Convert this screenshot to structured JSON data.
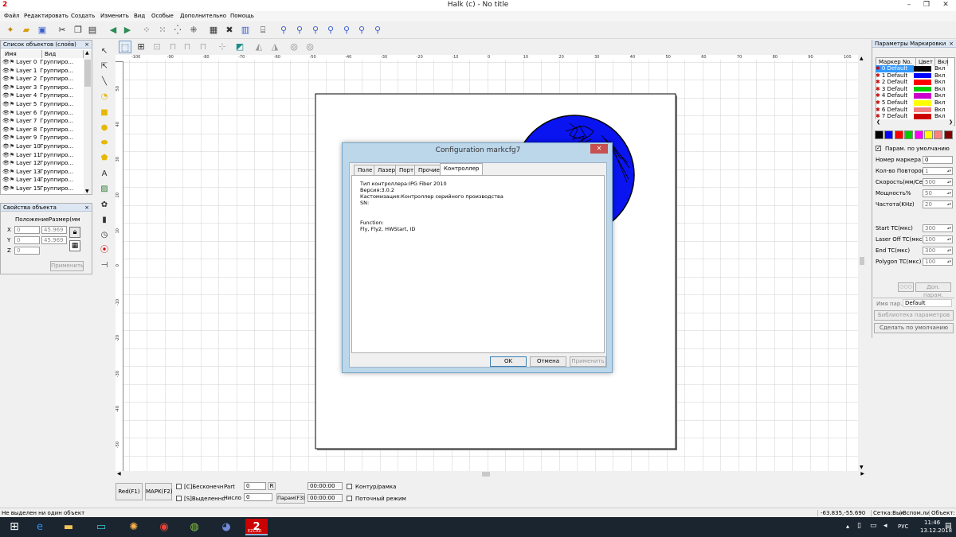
{
  "window": {
    "title": "Halk (c) - No title"
  },
  "menu": [
    "Файл",
    "Редактировать",
    "Создать",
    "Изменить",
    "Вид",
    "Особые",
    "Дополнительно",
    "Помощь"
  ],
  "layers_panel": {
    "title": "Список объектов (слоёв)",
    "close": "×",
    "columns": [
      "Имя",
      "Вид"
    ],
    "rows": [
      {
        "name": "Layer 0",
        "type": "Группиро..."
      },
      {
        "name": "Layer 1",
        "type": "Группиро..."
      },
      {
        "name": "Layer 2",
        "type": "Группиро..."
      },
      {
        "name": "Layer 3",
        "type": "Группиро..."
      },
      {
        "name": "Layer 4",
        "type": "Группиро..."
      },
      {
        "name": "Layer 5",
        "type": "Группиро..."
      },
      {
        "name": "Layer 6",
        "type": "Группиро..."
      },
      {
        "name": "Layer 7",
        "type": "Группиро..."
      },
      {
        "name": "Layer 8",
        "type": "Группиро..."
      },
      {
        "name": "Layer 9",
        "type": "Группиро..."
      },
      {
        "name": "Layer 10",
        "type": "Группиро..."
      },
      {
        "name": "Layer 11",
        "type": "Группиро..."
      },
      {
        "name": "Layer 12",
        "type": "Группиро..."
      },
      {
        "name": "Layer 13",
        "type": "Группиро..."
      },
      {
        "name": "Layer 14",
        "type": "Группиро..."
      },
      {
        "name": "Layer 15",
        "type": "Группиро..."
      }
    ]
  },
  "props_panel": {
    "title": "Свойства объекта",
    "close": "×",
    "pos_label": "Положение",
    "size_label": "Размер(мм",
    "x_label": "X",
    "y_label": "Y",
    "z_label": "Z",
    "x_value": "0",
    "y_value": "0",
    "z_value": "0",
    "w_value": "45.969",
    "h_value": "45.969",
    "apply": "Применить"
  },
  "ruler": {
    "top": [
      "-100",
      "-90",
      "-80",
      "-70",
      "-60",
      "-50",
      "-40",
      "-30",
      "-20",
      "-10",
      "0",
      "10",
      "20",
      "30",
      "40",
      "50",
      "60",
      "70",
      "80",
      "90",
      "100"
    ],
    "left": [
      "50",
      "40",
      "30",
      "20",
      "10",
      "0",
      "-10",
      "-20",
      "-30",
      "-40",
      "-50"
    ]
  },
  "dialog": {
    "title": "Configuration markcfg7",
    "close": "✕",
    "tabs": [
      "Поле",
      "Лазер",
      "Порт",
      "Прочие",
      "Контроллер"
    ],
    "lines": [
      "Тип контроллера:IPG Fiber 2010",
      "Версия:3.0.2",
      "Кастомизация:Контроллер серийного производства",
      "SN:",
      "Function:",
      "Fly, Fly2, HWStart, ID"
    ],
    "ok": "OK",
    "cancel": "Отмена",
    "apply": "Применить"
  },
  "marking_panel": {
    "title": "Параметры Маркировки",
    "close": "×",
    "columns": [
      "Маркер No.",
      "Цвет",
      "Вкл"
    ],
    "rows": [
      {
        "name": "0 Default",
        "color": "#000000",
        "on": "Вкл"
      },
      {
        "name": "1 Default",
        "color": "#0000ff",
        "on": "Вкл"
      },
      {
        "name": "2 Default",
        "color": "#ff0000",
        "on": "Вкл"
      },
      {
        "name": "3 Default",
        "color": "#00cc00",
        "on": "Вкл"
      },
      {
        "name": "4 Default",
        "color": "#cc00cc",
        "on": "Вкл"
      },
      {
        "name": "5 Default",
        "color": "#ffff00",
        "on": "Вкл"
      },
      {
        "name": "6 Default",
        "color": "#f08080",
        "on": "Вкл"
      },
      {
        "name": "7 Default",
        "color": "#cc0000",
        "on": "Вкл"
      }
    ],
    "palette": [
      "#000000",
      "#0000ff",
      "#ff0000",
      "#00cc00",
      "#ff00ff",
      "#ffff00",
      "#ff8080",
      "#800000"
    ],
    "default_param": "Парам. по умолчанию",
    "params": [
      {
        "label": "Номер маркера",
        "value": "0"
      },
      {
        "label": "Кол-во Повторов",
        "value": "1"
      },
      {
        "label": "Скорость(мм/Сек",
        "value": "500"
      },
      {
        "label": "Мощность%",
        "value": "50"
      },
      {
        "label": "Частота(KHz)",
        "value": "20"
      },
      {
        "label": "Start TC(мкс)",
        "value": "300"
      },
      {
        "label": "Laser Off TC(мкс)",
        "value": "100"
      },
      {
        "label": "End TC(мкс)",
        "value": "300"
      },
      {
        "label": "Polygon TC(мкс)",
        "value": "100"
      }
    ],
    "extra_btn": "Доп. парам.",
    "name_label": "Имя пар.",
    "name_value": "Default",
    "library": "Библиотека параметров",
    "make_default": "Сделать по умолчанию"
  },
  "bottom": {
    "red": "Red(F1)",
    "mark": "MAPK(F2)",
    "infinite": "[C]Бесконечн",
    "selected": "[S]Выделенно",
    "part_label": "Part",
    "part_value": "0",
    "count_label": "Число",
    "count_value": "0",
    "r_btn": "R",
    "param": "Парам(F3)",
    "time1": "00:00:00",
    "time2": "00:00:00",
    "contour": "Контур/рамка",
    "flow": "Поточный режим"
  },
  "status": {
    "left": "Не выделен ни один объект",
    "coords": "-63.835,-55.690",
    "grid": "Сетка:Вык",
    "guides": "Вспом.ли",
    "obj": "Объект:"
  },
  "taskbar": {
    "lang": "РУС",
    "time": "11:46",
    "date": "13.12.2018",
    "app_label": "EZCAD"
  }
}
